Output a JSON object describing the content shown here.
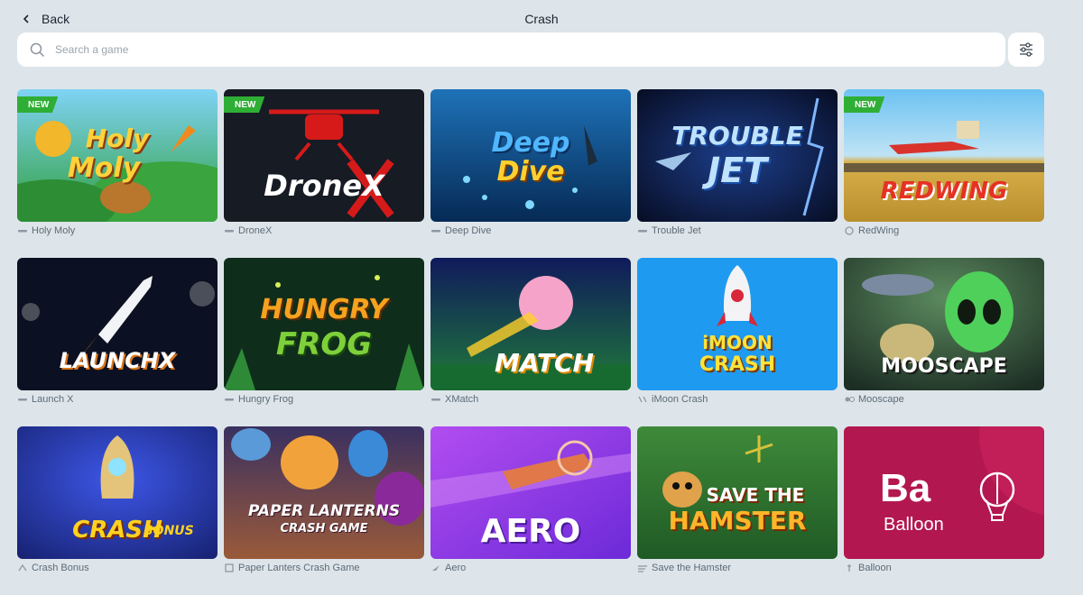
{
  "header": {
    "back_label": "Back",
    "title": "Crash"
  },
  "search": {
    "placeholder": "Search a game",
    "value": ""
  },
  "badge_label": "NEW",
  "games": [
    {
      "name": "Holy Moly",
      "art": [
        "Holy",
        "Moly"
      ],
      "new": true
    },
    {
      "name": "DroneX",
      "art": [
        "DroneX"
      ],
      "new": true
    },
    {
      "name": "Deep Dive",
      "art": [
        "Deep",
        "Dive"
      ],
      "new": false
    },
    {
      "name": "Trouble Jet",
      "art": [
        "TROUBLE",
        "JET"
      ],
      "new": false
    },
    {
      "name": "RedWing",
      "art": [
        "REDWING"
      ],
      "new": true
    },
    {
      "name": "Launch X",
      "art": [
        "LAUNCHX"
      ],
      "new": false
    },
    {
      "name": "Hungry Frog",
      "art": [
        "HUNGRY",
        "FROG"
      ],
      "new": false
    },
    {
      "name": "XMatch",
      "art": [
        "MATCH"
      ],
      "new": false
    },
    {
      "name": "iMoon Crash",
      "art": [
        "iMOON",
        "CRASH"
      ],
      "new": false
    },
    {
      "name": "Mooscape",
      "art": [
        "MOOSCAPE"
      ],
      "new": false
    },
    {
      "name": "Crash Bonus",
      "art": [
        "CRASH",
        "BONUS"
      ],
      "new": false
    },
    {
      "name": "Paper Lanters Crash Game",
      "art": [
        "PAPER LANTERNS",
        "CRASH GAME"
      ],
      "new": false
    },
    {
      "name": "Aero",
      "art": [
        "AERO"
      ],
      "new": false
    },
    {
      "name": "Save the Hamster",
      "art": [
        "SAVE THE",
        "HAMSTER"
      ],
      "new": false
    },
    {
      "name": "Balloon",
      "art": [
        "Ba",
        "Balloon"
      ],
      "new": false
    }
  ],
  "colors": {
    "background": "#dde5ea",
    "badge": "#2fae35",
    "caption": "#5d6a76"
  }
}
